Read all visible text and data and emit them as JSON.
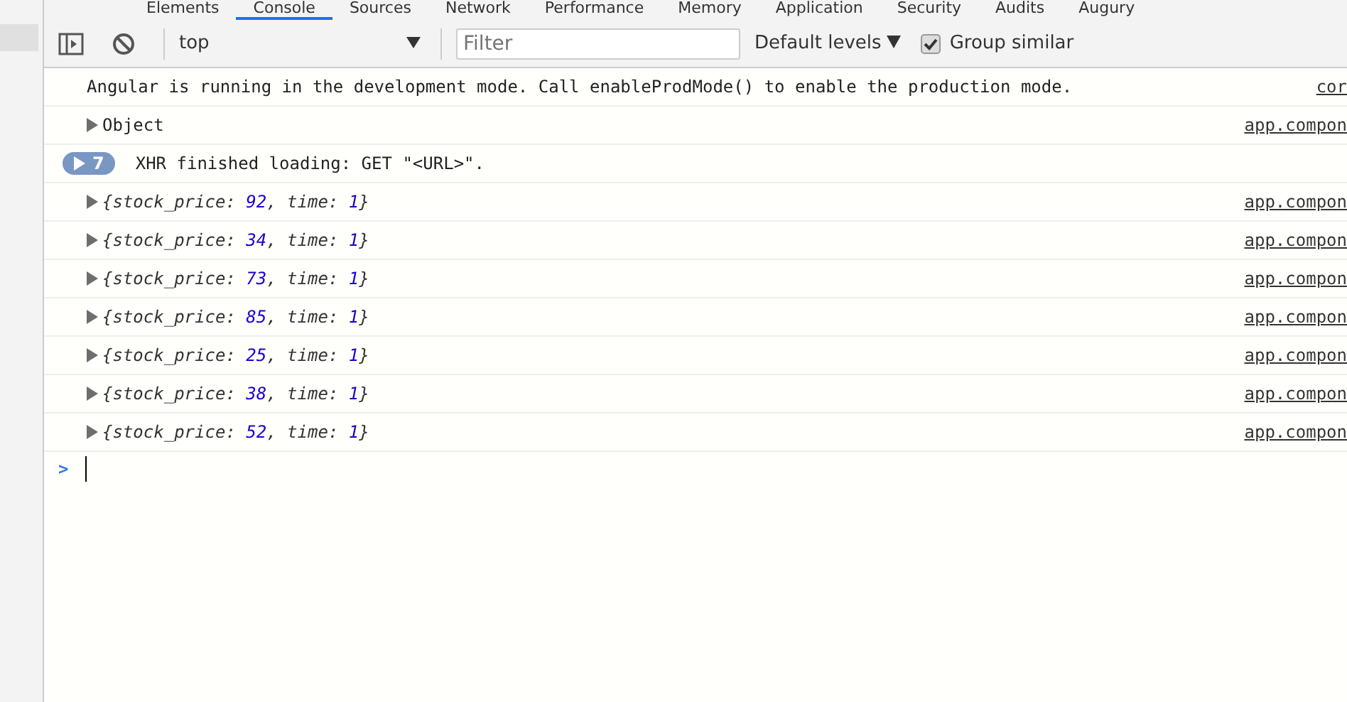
{
  "tabs": [
    {
      "label": "Elements",
      "selected": false
    },
    {
      "label": "Console",
      "selected": true
    },
    {
      "label": "Sources",
      "selected": false
    },
    {
      "label": "Network",
      "selected": false
    },
    {
      "label": "Performance",
      "selected": false
    },
    {
      "label": "Memory",
      "selected": false
    },
    {
      "label": "Application",
      "selected": false
    },
    {
      "label": "Security",
      "selected": false
    },
    {
      "label": "Audits",
      "selected": false
    },
    {
      "label": "Augury",
      "selected": false
    }
  ],
  "toolbar": {
    "context": "top",
    "filter_placeholder": "Filter",
    "levels": "Default levels",
    "group_similar": {
      "label": "Group similar",
      "checked": true
    }
  },
  "messages": [
    {
      "kind": "text",
      "text": "Angular is running in the development mode. Call enableProdMode() to enable the production mode.",
      "source": "cor"
    },
    {
      "kind": "object",
      "text": "Object",
      "source": "app.compon"
    },
    {
      "kind": "group",
      "count": "7",
      "text": "XHR finished loading: GET \"<URL>\"."
    },
    {
      "kind": "props",
      "parts": [
        {
          "kind": "plain",
          "text": "{stock_price: "
        },
        {
          "kind": "number",
          "text": "92"
        },
        {
          "kind": "plain",
          "text": ", time: "
        },
        {
          "kind": "number",
          "text": "1"
        },
        {
          "kind": "plain",
          "text": "}"
        }
      ],
      "source": "app.compon"
    },
    {
      "kind": "props",
      "parts": [
        {
          "kind": "plain",
          "text": "{stock_price: "
        },
        {
          "kind": "number",
          "text": "34"
        },
        {
          "kind": "plain",
          "text": ", time: "
        },
        {
          "kind": "number",
          "text": "1"
        },
        {
          "kind": "plain",
          "text": "}"
        }
      ],
      "source": "app.compon"
    },
    {
      "kind": "props",
      "parts": [
        {
          "kind": "plain",
          "text": "{stock_price: "
        },
        {
          "kind": "number",
          "text": "73"
        },
        {
          "kind": "plain",
          "text": ", time: "
        },
        {
          "kind": "number",
          "text": "1"
        },
        {
          "kind": "plain",
          "text": "}"
        }
      ],
      "source": "app.compon"
    },
    {
      "kind": "props",
      "parts": [
        {
          "kind": "plain",
          "text": "{stock_price: "
        },
        {
          "kind": "number",
          "text": "85"
        },
        {
          "kind": "plain",
          "text": ", time: "
        },
        {
          "kind": "number",
          "text": "1"
        },
        {
          "kind": "plain",
          "text": "}"
        }
      ],
      "source": "app.compon"
    },
    {
      "kind": "props",
      "parts": [
        {
          "kind": "plain",
          "text": "{stock_price: "
        },
        {
          "kind": "number",
          "text": "25"
        },
        {
          "kind": "plain",
          "text": ", time: "
        },
        {
          "kind": "number",
          "text": "1"
        },
        {
          "kind": "plain",
          "text": "}"
        }
      ],
      "source": "app.compon"
    },
    {
      "kind": "props",
      "parts": [
        {
          "kind": "plain",
          "text": "{stock_price: "
        },
        {
          "kind": "number",
          "text": "38"
        },
        {
          "kind": "plain",
          "text": ", time: "
        },
        {
          "kind": "number",
          "text": "1"
        },
        {
          "kind": "plain",
          "text": "}"
        }
      ],
      "source": "app.compon"
    },
    {
      "kind": "props",
      "parts": [
        {
          "kind": "plain",
          "text": "{stock_price: "
        },
        {
          "kind": "number",
          "text": "52"
        },
        {
          "kind": "plain",
          "text": ", time: "
        },
        {
          "kind": "number",
          "text": "1"
        },
        {
          "kind": "plain",
          "text": "}"
        }
      ],
      "source": "app.compon"
    }
  ],
  "prompt": {
    "symbol": ">"
  }
}
